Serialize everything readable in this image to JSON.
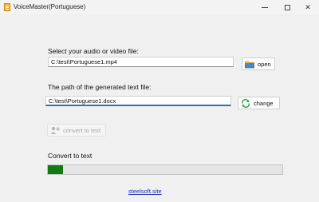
{
  "window": {
    "title": "VoiceMaster(Portuguese)",
    "controls": {
      "minimize": "",
      "maximize": "",
      "close": "✕"
    }
  },
  "input_section": {
    "label": "Select your audio or video file:",
    "value": "C:\\test\\Portuguese1.mp4",
    "button_label": "open",
    "button_icon": "folder-icon"
  },
  "output_section": {
    "label": "The path of the generated text file:",
    "value": "C:\\test\\Portuguese1.docx",
    "button_label": "change",
    "button_icon": "refresh-icon"
  },
  "convert_button": {
    "label": "convert to text",
    "enabled": false,
    "icon": "speech-icon"
  },
  "progress": {
    "label": "Convert to text",
    "fraction": 0.065,
    "fill_color": "#127a13"
  },
  "footer": {
    "link_text": "steelsoft.site",
    "link_color": "#1a2fb0"
  }
}
